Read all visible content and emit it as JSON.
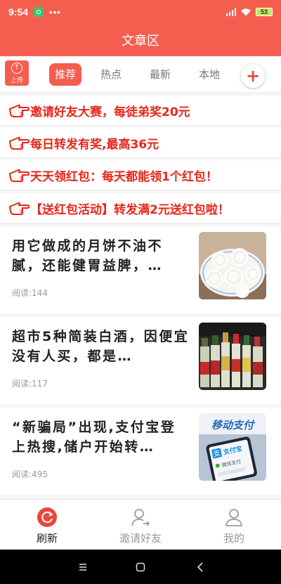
{
  "status_bar": {
    "time": "9:54",
    "dots": "•••",
    "battery": "53"
  },
  "header": {
    "title": "文章区"
  },
  "upload": {
    "label": "上传",
    "icon": "upload-icon"
  },
  "tabs": [
    {
      "label": "推荐",
      "active": true
    },
    {
      "label": "热点",
      "active": false
    },
    {
      "label": "最新",
      "active": false
    },
    {
      "label": "本地",
      "active": false
    }
  ],
  "add_button": {
    "icon": "plus-icon"
  },
  "promos": [
    {
      "text": "邀请好友大赛，每徒弟奖20元",
      "icon": "pointing-hand-icon"
    },
    {
      "text": "每日转发有奖,最高36元",
      "icon": "pointing-hand-icon"
    },
    {
      "text": "天天领红包：每天都能领1个红包！",
      "icon": "pointing-hand-icon"
    },
    {
      "text": "【送红包活动】转发满2元送红包啦！",
      "icon": "pointing-hand-icon"
    }
  ],
  "articles": [
    {
      "title": "用它做成的月饼不油不腻，还能健胃益脾，…",
      "reads": "阅读:144"
    },
    {
      "title": "超市5种简装白酒，因便宜没有人买，都是…",
      "reads": "阅读:117"
    },
    {
      "title": "“新骗局”出现,支付宝登上热搜,储户开始转…",
      "reads": "阅读:495",
      "thumb_text": "移动支付",
      "thumb_brand": "支付宝",
      "thumb_wechat": "微信支付"
    }
  ],
  "bottom_nav": [
    {
      "label": "刷新",
      "icon": "refresh-icon",
      "active": true
    },
    {
      "label": "邀请好友",
      "icon": "invite-friend-icon",
      "active": false
    },
    {
      "label": "我的",
      "icon": "profile-icon",
      "active": false
    }
  ],
  "colors": {
    "primary": "#f55d4f",
    "promo_text": "#e8261c"
  }
}
